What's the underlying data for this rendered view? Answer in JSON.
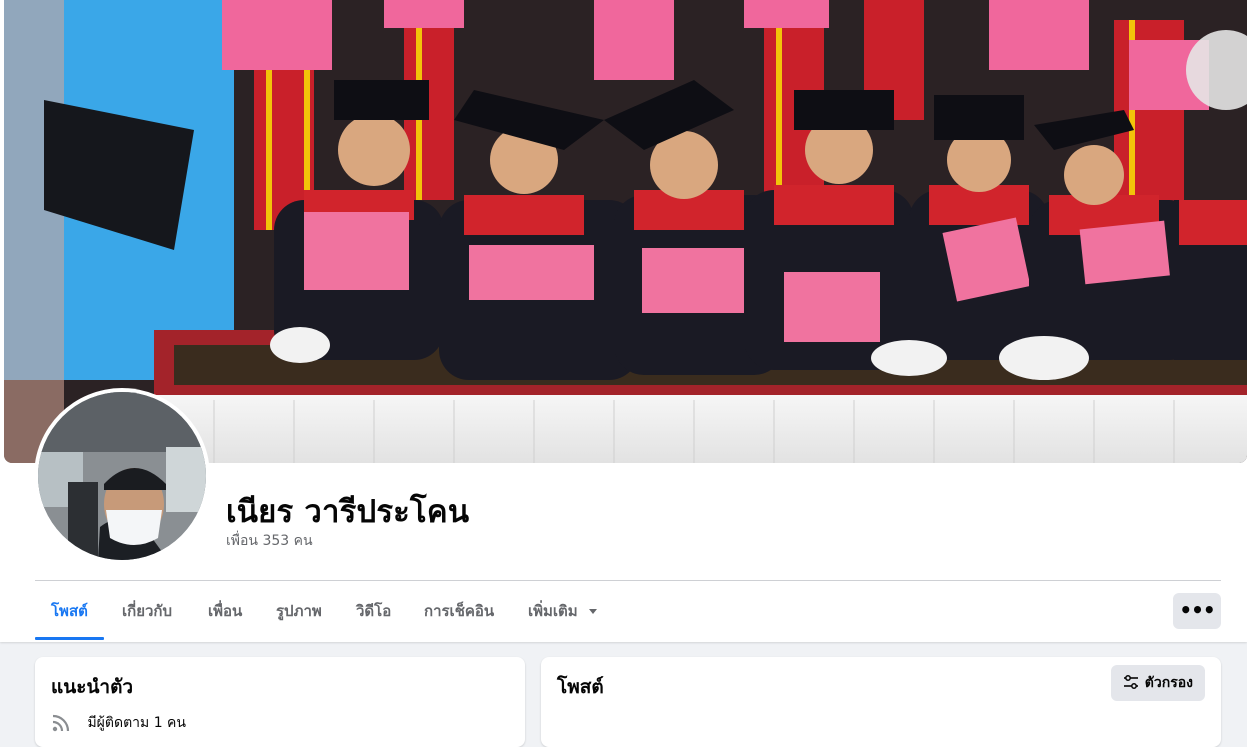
{
  "profile": {
    "name": "เนียร วารีประโคน",
    "friends": "เพื่อน 353 คน"
  },
  "tabs": [
    {
      "label": "โพสต์"
    },
    {
      "label": "เกี่ยวกับ"
    },
    {
      "label": "เพื่อน"
    },
    {
      "label": "รูปภาพ"
    },
    {
      "label": "วิดีโอ"
    },
    {
      "label": "การเช็คอิน"
    },
    {
      "label": "เพิ่มเติม"
    }
  ],
  "intro": {
    "title": "แนะนำตัว",
    "followers": "มีผู้ติดตาม 1 คน"
  },
  "posts": {
    "title": "โพสต์",
    "filter_label": "ตัวกรอง"
  },
  "colors": {
    "accent": "#1877f2",
    "page_bg": "#f0f2f5",
    "button_bg": "#e4e6eb",
    "muted_text": "#65676b"
  },
  "icons": {
    "more": "three-dots-icon",
    "dropdown": "caret-down-icon",
    "filter": "filter-sliders-icon",
    "followers": "rss-icon"
  }
}
